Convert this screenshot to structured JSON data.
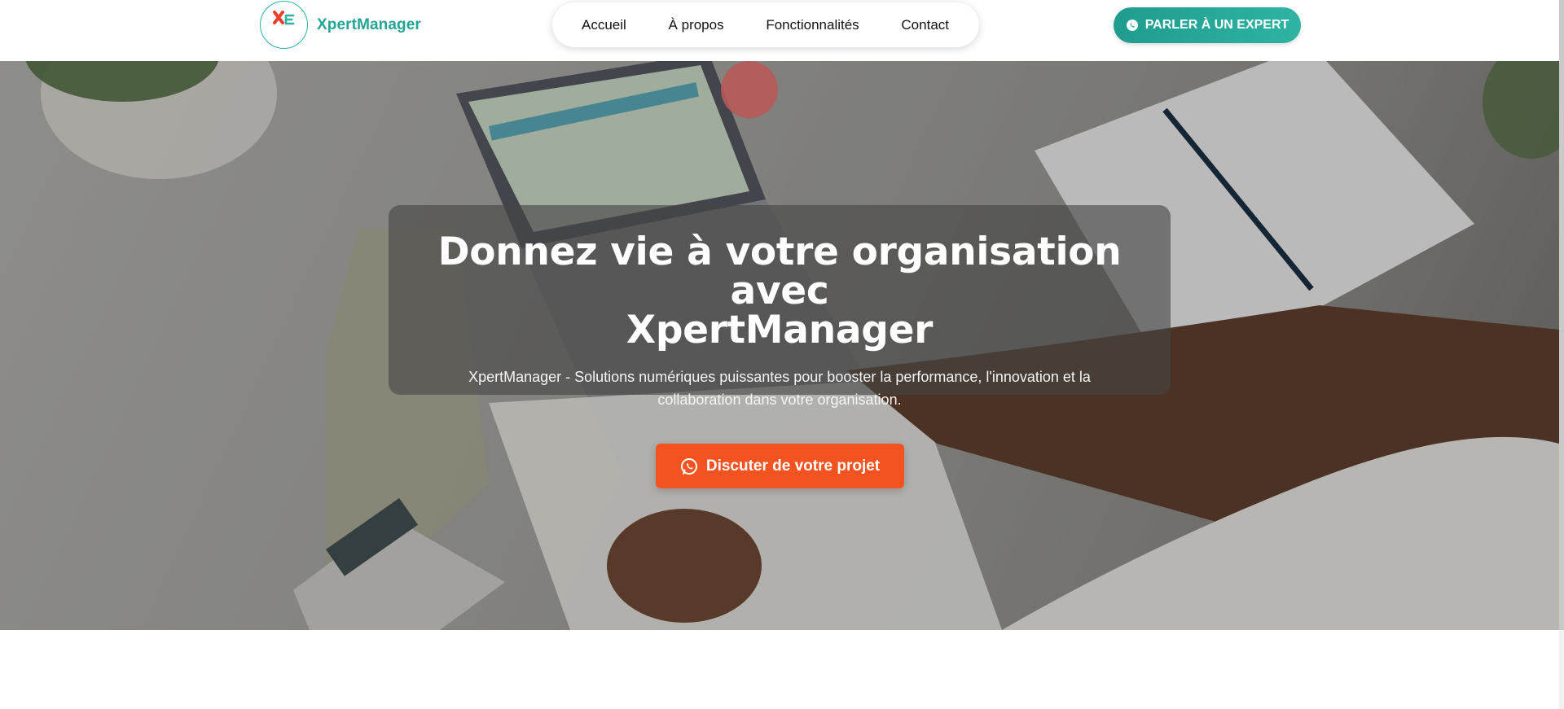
{
  "brand": {
    "name": "XpertManager",
    "logo_icon": "xpertmanager-logo"
  },
  "nav": {
    "items": [
      {
        "label": "Accueil"
      },
      {
        "label": "À propos"
      },
      {
        "label": "Fonctionnalités"
      },
      {
        "label": "Contact"
      }
    ]
  },
  "header": {
    "cta_label": "PARLER À UN EXPERT",
    "cta_icon": "chat-icon"
  },
  "hero": {
    "title_line1": "Donnez vie à votre organisation avec",
    "title_line2": "XpertManager",
    "subtitle": "XpertManager - Solutions numériques puissantes pour booster la performance, l'innovation et la collaboration dans votre organisation.",
    "cta_label": "Discuter de votre projet",
    "cta_icon": "whatsapp-icon"
  },
  "colors": {
    "brand_teal": "#23a596",
    "cta_orange": "#f25320",
    "card_overlay": "rgba(70,70,70,0.62)"
  }
}
